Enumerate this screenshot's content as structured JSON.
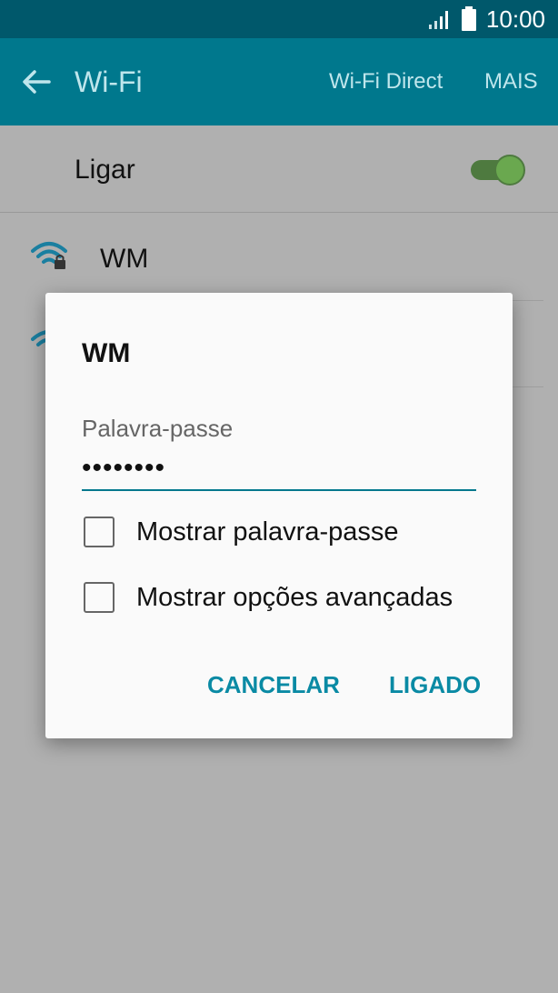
{
  "status_bar": {
    "time": "10:00",
    "signal_icon": "signal-icon",
    "battery_icon": "battery-icon"
  },
  "app_bar": {
    "back_icon": "back-arrow-icon",
    "title": "Wi-Fi",
    "wifi_direct_label": "Wi-Fi Direct",
    "more_label": "MAIS"
  },
  "ligar": {
    "label": "Ligar",
    "toggle_on": true
  },
  "networks": [
    {
      "name": "WM",
      "secured": true
    }
  ],
  "dialog": {
    "title": "WM",
    "password_label": "Palavra-passe",
    "password_value": "••••••••",
    "show_password_label": "Mostrar palavra-passe",
    "show_advanced_label": "Mostrar opções avançadas",
    "cancel_label": "CANCELAR",
    "connect_label": "LIGADO"
  },
  "colors": {
    "accent": "#00788d",
    "button_text": "#0a8aa4",
    "toggle_on": "#6aa84f"
  }
}
